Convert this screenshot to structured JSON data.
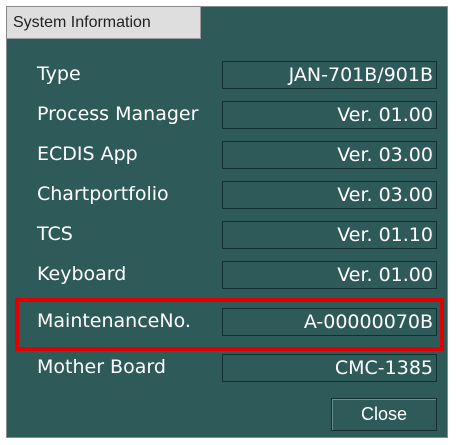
{
  "window": {
    "title": "System Information"
  },
  "rows": [
    {
      "label": "Type",
      "value": "JAN-701B/901B"
    },
    {
      "label": "Process Manager",
      "value": "Ver. 01.00"
    },
    {
      "label": "ECDIS App",
      "value": "Ver. 03.00"
    },
    {
      "label": "Chartportfolio",
      "value": "Ver. 03.00"
    },
    {
      "label": "TCS",
      "value": "Ver. 01.10"
    },
    {
      "label": "Keyboard",
      "value": "Ver. 01.00"
    },
    {
      "label": "MaintenanceNo.",
      "value": "A-00000070B"
    },
    {
      "label": "Mother Board",
      "value": "CMC-1385"
    }
  ],
  "buttons": {
    "close_label": "Close"
  },
  "colors": {
    "panel_background": "#2f5a5a",
    "highlight_border": "#e00000",
    "text": "#ffffff"
  }
}
